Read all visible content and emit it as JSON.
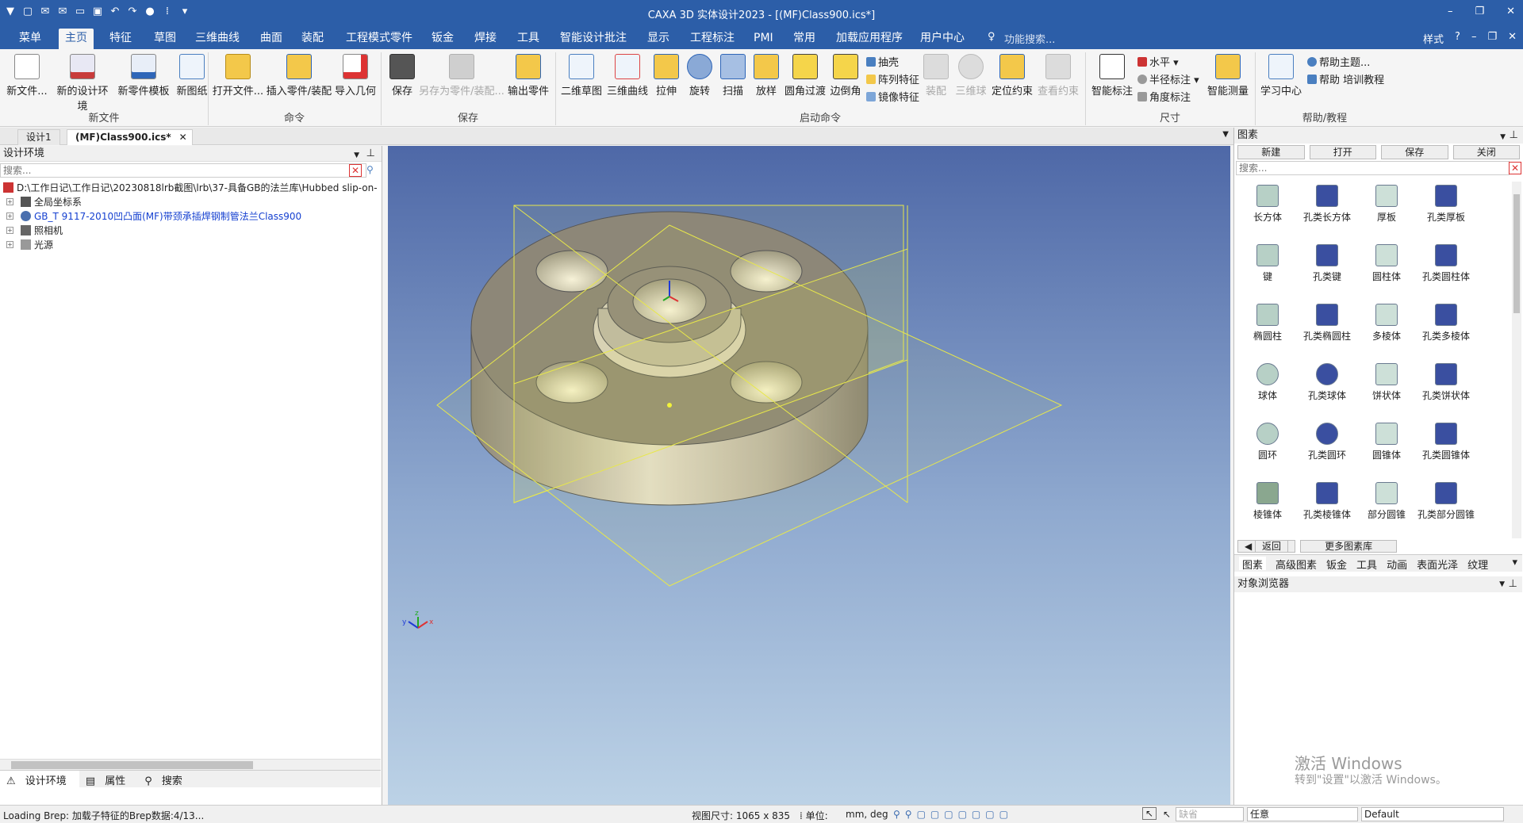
{
  "window": {
    "title": "CAXA 3D 实体设计2023 - [(MF)Class900.ics*]"
  },
  "menu_tabs": [
    "菜单",
    "主页",
    "特征",
    "草图",
    "三维曲线",
    "曲面",
    "装配",
    "工程模式零件",
    "钣金",
    "焊接",
    "工具",
    "智能设计批注",
    "显示",
    "工程标注",
    "PMI",
    "常用",
    "加载应用程序",
    "用户中心"
  ],
  "active_tab": "主页",
  "feature_search": "功能搜索...",
  "menu_right": {
    "style": "样式"
  },
  "ribbon": {
    "new_file": {
      "group": "新文件",
      "buttons": [
        "新文件...",
        "新的设计环境",
        "新零件模板",
        "新图纸"
      ]
    },
    "command": {
      "group": "命令",
      "buttons": [
        "打开文件...",
        "插入零件/装配",
        "导入几何"
      ]
    },
    "save": {
      "group": "保存",
      "buttons": [
        "保存",
        "另存为零件/装配...",
        "输出零件"
      ]
    },
    "launch": {
      "group": "启动命令",
      "buttons": [
        "二维草图",
        "三维曲线",
        "拉伸",
        "旋转",
        "扫描",
        "放样",
        "圆角过渡",
        "边倒角"
      ],
      "small": [
        "抽壳",
        "阵列特征",
        "镜像特征"
      ],
      "dim_buttons": [
        "装配",
        "三维球",
        "定位约束",
        "查看约束"
      ]
    },
    "dim": {
      "group": "尺寸",
      "buttons": [
        "智能标注",
        "智能测量"
      ],
      "small": [
        "水平",
        "半径标注",
        "角度标注"
      ]
    },
    "help": {
      "group": "帮助/教程",
      "buttons": [
        "学习中心"
      ],
      "small": [
        "帮助主题...",
        "帮助 培训教程"
      ]
    }
  },
  "doc_tabs": [
    "设计1",
    "(MF)Class900.ics*"
  ],
  "left_panel": {
    "title": "设计环境",
    "search_placeholder": "搜索...",
    "tree": [
      "D:\\工作日记\\工作日记\\20230818lrb截图\\lrb\\37-具备GB的法兰库\\Hubbed slip-on-",
      "全局坐标系",
      "GB_T 9117-2010凹凸面(MF)带颈承插焊钢制管法兰Class900",
      "照相机",
      "光源"
    ],
    "bottom_tabs": [
      "设计环境",
      "属性",
      "搜索"
    ]
  },
  "right_panel": {
    "title": "图素",
    "buttons": [
      "新建",
      "打开",
      "保存",
      "关闭"
    ],
    "search_placeholder": "搜索...",
    "items": [
      "长方体",
      "孔类长方体",
      "厚板",
      "孔类厚板",
      "键",
      "孔类键",
      "圆柱体",
      "孔类圆柱体",
      "椭圆柱",
      "孔类椭圆柱",
      "多棱体",
      "孔类多棱体",
      "球体",
      "孔类球体",
      "饼状体",
      "孔类饼状体",
      "圆环",
      "孔类圆环",
      "圆锥体",
      "孔类圆锥体",
      "棱锥体",
      "孔类棱锥体",
      "部分圆锥",
      "孔类部分圆锥"
    ],
    "back": "返回",
    "more": "更多图素库",
    "lib_tabs": [
      "图素",
      "高级图素",
      "钣金",
      "工具",
      "动画",
      "表面光泽",
      "纹理"
    ],
    "object_browser": "对象浏览器",
    "watermark_title": "激活 Windows",
    "watermark_text": "转到\"设置\"以激活 Windows。"
  },
  "status": {
    "loading": "Loading Brep: 加载子特征的Brep数据:4/13...",
    "view_size": "视图尺寸: 1065 x  835",
    "unit_label": "单位:",
    "unit_value": "mm, deg",
    "filter1": "缺省",
    "filter2": "任意",
    "filter3": "Default"
  },
  "colors": {
    "accent": "#2c5ea8",
    "body": "#c6bfa8",
    "plane": "#e8e84a"
  }
}
